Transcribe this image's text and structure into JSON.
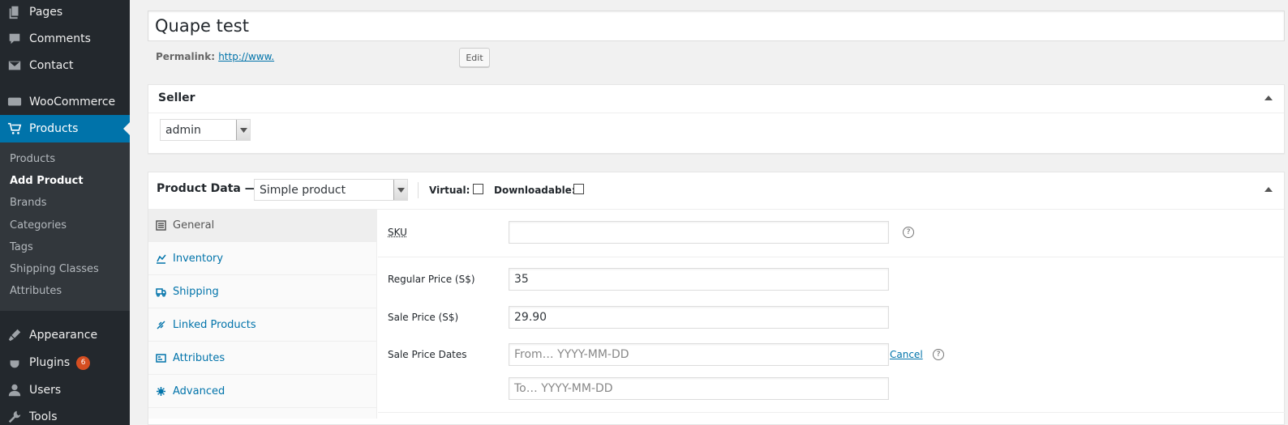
{
  "sidebar": {
    "items": [
      {
        "label": "Pages",
        "icon": "pages-icon"
      },
      {
        "label": "Comments",
        "icon": "comments-icon"
      },
      {
        "label": "Contact",
        "icon": "mail-icon"
      },
      {
        "label": "WooCommerce",
        "icon": "woo-icon"
      },
      {
        "label": "Products",
        "icon": "cart-icon"
      },
      {
        "label": "Appearance",
        "icon": "brush-icon"
      },
      {
        "label": "Plugins",
        "icon": "plugin-icon",
        "badge": "6"
      },
      {
        "label": "Users",
        "icon": "user-icon"
      },
      {
        "label": "Tools",
        "icon": "wrench-icon"
      }
    ],
    "submenu": [
      "Products",
      "Add Product",
      "Brands",
      "Categories",
      "Tags",
      "Shipping Classes",
      "Attributes"
    ]
  },
  "post": {
    "title": "Quape test",
    "permalink_label": "Permalink:",
    "permalink_url": "http://www.",
    "edit_label": "Edit"
  },
  "seller": {
    "title": "Seller",
    "value": "admin"
  },
  "product_data": {
    "title": "Product Data —",
    "type": "Simple product",
    "virtual_label": "Virtual:",
    "downloadable_label": "Downloadable:",
    "tabs": [
      "General",
      "Inventory",
      "Shipping",
      "Linked Products",
      "Attributes",
      "Advanced"
    ],
    "fields": {
      "sku_label": "SKU",
      "sku_value": "",
      "regular_price_label": "Regular Price (S$)",
      "regular_price_value": "35",
      "sale_price_label": "Sale Price (S$)",
      "sale_price_value": "29.90",
      "sale_dates_label": "Sale Price Dates",
      "from_placeholder": "From… YYYY-MM-DD",
      "to_placeholder": "To…  YYYY-MM-DD",
      "cancel_label": "Cancel",
      "help_glyph": "?"
    }
  },
  "colors": {
    "sidebar_bg": "#23282d",
    "submenu_bg": "#32373c",
    "accent": "#0073aa",
    "badge": "#d54e21"
  }
}
